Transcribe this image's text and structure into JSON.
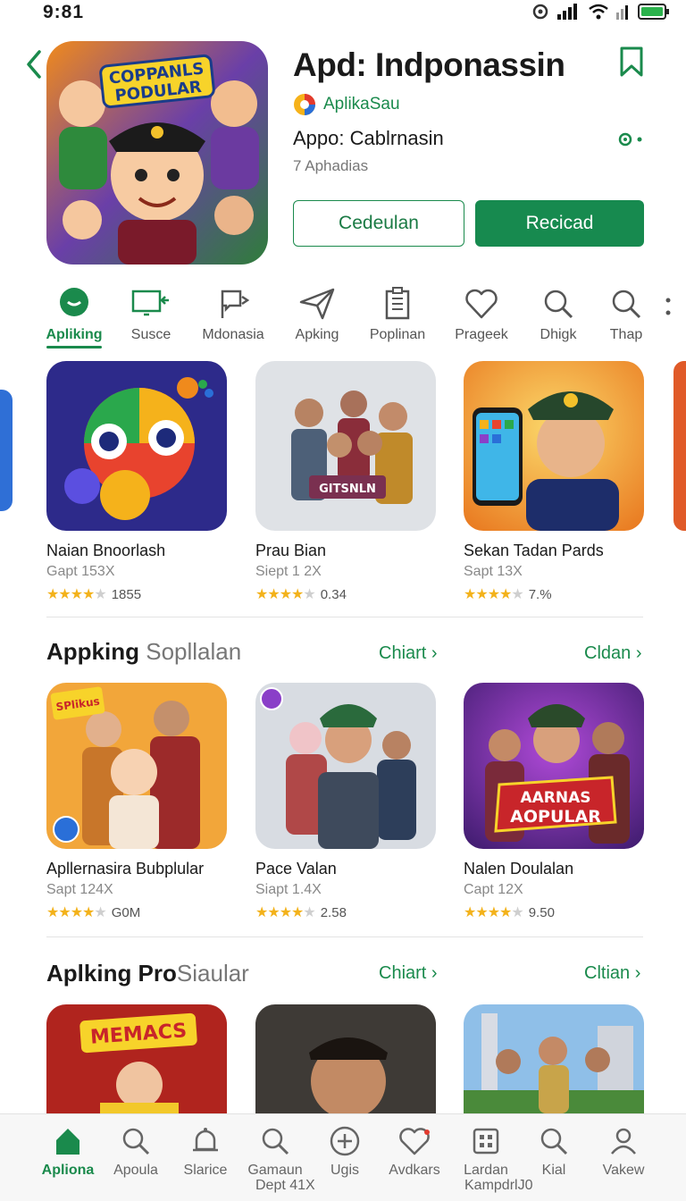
{
  "status_bar": {
    "time": "9:81"
  },
  "header": {
    "app_title": "Apd: Indponassin",
    "developer": "AplikaSau",
    "subtitle": "Appo: Cablrnasin",
    "meta": "7 Aphadias",
    "hero_caption_line1": "COPPANLS",
    "hero_caption_line2": "PODULAR",
    "btn_outline": "Cedeulan",
    "btn_solid": "Recicad",
    "accent_color": "#1a8a4c"
  },
  "tabs": [
    {
      "label": "Apliking",
      "icon": "chat-bubble-icon",
      "active": true
    },
    {
      "label": "Susce",
      "icon": "screen-cast-icon",
      "active": false
    },
    {
      "label": "Mdonasia",
      "icon": "flag-icon",
      "active": false
    },
    {
      "label": "Apking",
      "icon": "send-icon",
      "active": false
    },
    {
      "label": "Poplinan",
      "icon": "clipboard-icon",
      "active": false
    },
    {
      "label": "Prageek",
      "icon": "heart-icon",
      "active": false
    },
    {
      "label": "Dhigk",
      "icon": "search-icon",
      "active": false
    },
    {
      "label": "Thap",
      "icon": "search-icon",
      "active": false
    }
  ],
  "row1": [
    {
      "title": "Naian Bnoorlash",
      "sub": "Gapt 153X",
      "rating": 4,
      "count": "1855"
    },
    {
      "title": "Prau Bian",
      "sub": "Siept 1 2X",
      "rating": 4,
      "count": "0.34",
      "banner": "GITSNLN"
    },
    {
      "title": "Sekan Tadan Pards",
      "sub": "Sapt 13X",
      "rating": 4,
      "count": "7.%"
    }
  ],
  "section2": {
    "title_bold": "Appking",
    "title_light": "Sopllalan",
    "link1": "Chiart",
    "link2": "Cldan",
    "cards": [
      {
        "title": "Apllernasira Bubplular",
        "sub": "Sapt 124X",
        "rating": 4,
        "count": "G0M",
        "badge": "SPlikus"
      },
      {
        "title": "Pace Valan",
        "sub": "Siapt 1.4X",
        "rating": 4,
        "count": "2.58"
      },
      {
        "title": "Nalen Doulalan",
        "sub": "Capt 12X",
        "rating": 4,
        "count": "9.50",
        "banner1": "AARNAS",
        "banner2": "AOPULAR"
      }
    ]
  },
  "section3": {
    "title_bold": "Aplking Pro",
    "title_light": "Siaular",
    "link1": "Chiart",
    "link2": "Cltian",
    "cards": [
      {
        "banner": "MEMACS"
      },
      {},
      {}
    ]
  },
  "bottom_nav": [
    {
      "label": "Apliona",
      "icon": "home-icon",
      "active": true
    },
    {
      "label": "Apoula",
      "icon": "search-icon",
      "active": false
    },
    {
      "label": "Slarice",
      "icon": "bell-icon",
      "active": false
    },
    {
      "label": "Gamaun",
      "icon": "search-icon",
      "active": false
    },
    {
      "label": "Ugis",
      "icon": "plus-circle-icon",
      "active": false
    },
    {
      "label": "Avdkars",
      "icon": "heart-icon",
      "active": false
    },
    {
      "label": "Lardan",
      "icon": "grid-app-icon",
      "active": false
    },
    {
      "label": "Kial",
      "icon": "search-icon",
      "active": false
    },
    {
      "label": "Vakew",
      "icon": "profile-icon",
      "active": false
    }
  ],
  "bottom_sub": {
    "left": "Dept 41X",
    "right": "KampdrlJ0"
  }
}
